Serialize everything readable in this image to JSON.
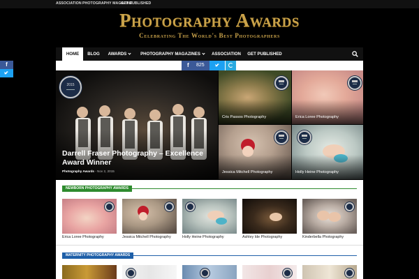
{
  "topnav": [
    "ASSOCIATION",
    "PHOTOGRAPHY MAGAZINE",
    "GET PUBLISHED"
  ],
  "logo": {
    "title": "Photography Awards",
    "subtitle": "Celebrating The World's Best Photographers"
  },
  "nav": {
    "items": [
      {
        "label": "HOME",
        "active": true,
        "dropdown": false
      },
      {
        "label": "BLOG",
        "active": false,
        "dropdown": false
      },
      {
        "label": "AWARDS",
        "active": false,
        "dropdown": true
      },
      {
        "label": "PHOTOGRAPHY MAGAZINES",
        "active": false,
        "dropdown": true
      },
      {
        "label": "ASSOCIATION",
        "active": false,
        "dropdown": false
      },
      {
        "label": "GET PUBLISHED",
        "active": false,
        "dropdown": false
      }
    ],
    "search_icon": "search-icon"
  },
  "social": {
    "facebook_icon": "f",
    "facebook_count": "825"
  },
  "side_share": {
    "facebook_icon": "f"
  },
  "featured": {
    "main": {
      "title": "Darrell Fraser Photography – Excellence Award Winner",
      "category": "Photography Awards",
      "separator": "-",
      "date": "Nov 2, 2015"
    },
    "tiles": [
      {
        "caption": "Cris Passos Photography"
      },
      {
        "caption": "Erica Loree Photography"
      },
      {
        "caption": "Jessica Mitchell Photography"
      },
      {
        "caption": "Holly Heine Photography"
      }
    ],
    "badge_text": "2015"
  },
  "newborn": {
    "heading": "NEWBORN PHOTOGRAPHY AWARDS",
    "items": [
      {
        "caption": "Erica Loree Photography"
      },
      {
        "caption": "Jessica Mitchell Photography"
      },
      {
        "caption": "Holly Heine Photography"
      },
      {
        "caption": "Ashley Ide Photography"
      },
      {
        "caption": "Kinderbella Photography"
      }
    ]
  },
  "maternity": {
    "heading": "MATERNITY PHOTOGRAPHY AWARDS"
  },
  "colors": {
    "gold": "#c9a24a",
    "nav_bg": "#111111",
    "newborn_green": "#2e8b2e",
    "maternity_blue": "#1e5fa8",
    "facebook": "#3b5998",
    "twitter": "#1da1f2"
  }
}
